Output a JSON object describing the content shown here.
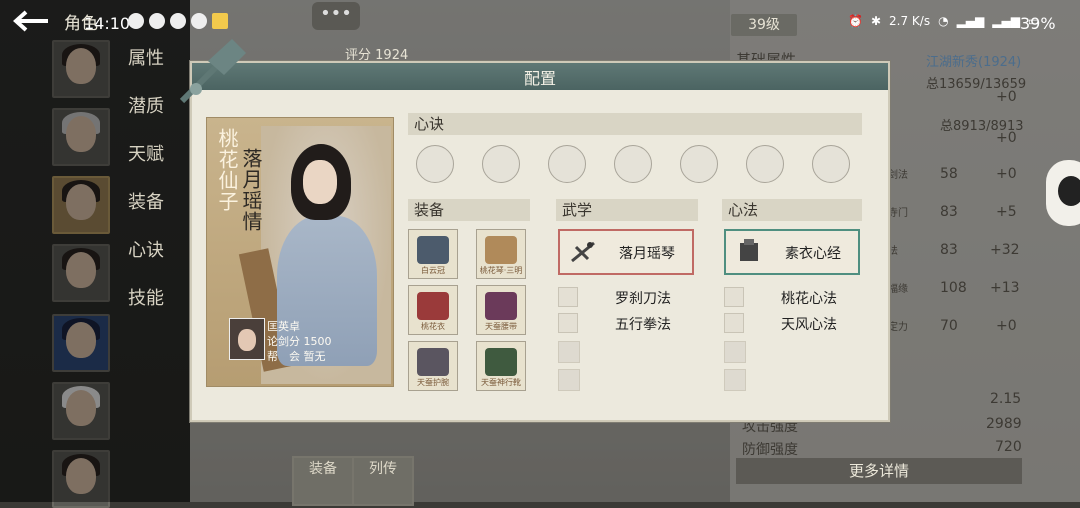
{
  "status_bar": {
    "time": "14:10",
    "net_speed": "2.7 K/s",
    "battery": "39%"
  },
  "header": {
    "title": "角色"
  },
  "side_menu": [
    "属性",
    "潜质",
    "天赋",
    "装备",
    "心诀",
    "技能"
  ],
  "background_panel": {
    "level": "39级",
    "score_label": "评分",
    "score": "1924",
    "section_title": "基础属性",
    "rank_title": "江湖新秀(1924)",
    "hp_label": "总",
    "hp": "13659/13659",
    "mp_label": "总",
    "mp": "8913/8913",
    "plus0": "+0",
    "attrs": [
      {
        "label": "剑法",
        "value": "58",
        "bonus": "+0"
      },
      {
        "label": "寺门",
        "value": "83",
        "bonus": "+5"
      },
      {
        "label": "法",
        "value": "83",
        "bonus": "+32"
      },
      {
        "label": "福缘",
        "value": "108",
        "bonus": "+13"
      },
      {
        "label": "定力",
        "value": "70",
        "bonus": "+0"
      }
    ],
    "bottom_stats": [
      {
        "label": "",
        "value": "2.15"
      },
      {
        "label": "攻击强度",
        "value": "2989"
      },
      {
        "label": "防御强度",
        "value": "720"
      }
    ],
    "more_button": "更多详情",
    "tabs": [
      "装备",
      "列传"
    ],
    "chat_dots": "•••"
  },
  "dialog": {
    "title": "配置",
    "character": {
      "title": "桃花仙子",
      "name": "落月瑶情",
      "owner_name": "匡英卓",
      "owner_score": "论剑分 1500",
      "owner_guild": "帮　会 暂无"
    },
    "heart_section": "心诀",
    "equip_section": "装备",
    "equipment": [
      {
        "label": "白云冠",
        "color": "#4c5b6c"
      },
      {
        "label": "桃花琴·三明",
        "color": "#b08a5a"
      },
      {
        "label": "桃花衣",
        "color": "#9a3a3a"
      },
      {
        "label": "天蚕腰带",
        "color": "#6b3a5a"
      },
      {
        "label": "天蚕护腕",
        "color": "#5a5560"
      },
      {
        "label": "天蚕神行靴",
        "color": "#3f5a3f"
      }
    ],
    "martial_section": "武学",
    "martial_main": "落月瑶琴",
    "martial_list": [
      "罗刹刀法",
      "五行拳法"
    ],
    "mind_section": "心法",
    "mind_main": "素衣心经",
    "mind_list": [
      "桃花心法",
      "天风心法"
    ]
  }
}
